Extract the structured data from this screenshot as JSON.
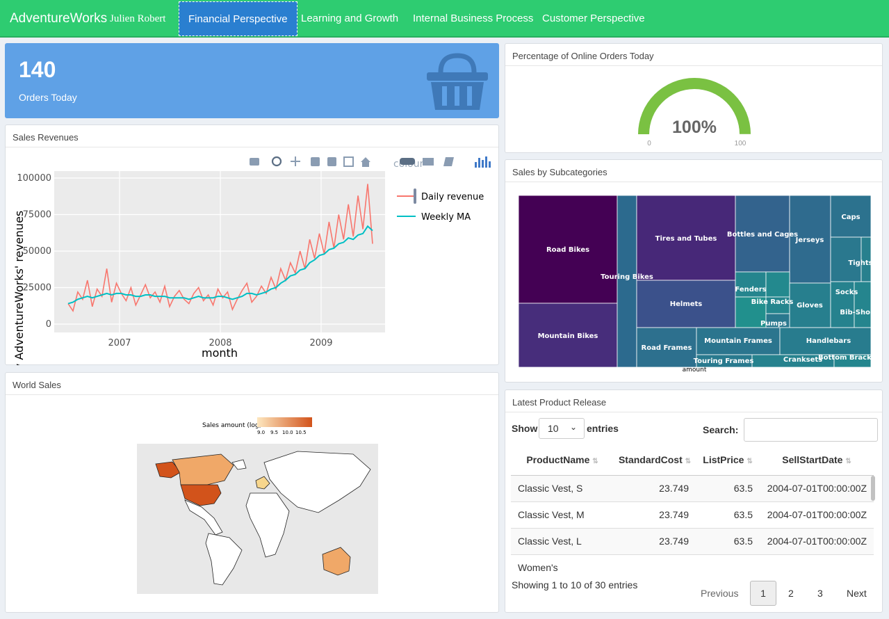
{
  "nav": {
    "brand": "AdventureWorks",
    "user": "Julien Robert",
    "tabs": [
      "Financial Perspective",
      "Learning and Growth",
      "Internal Business Process",
      "Customer Perspective"
    ]
  },
  "orders": {
    "value": "140",
    "label": "Orders Today",
    "icon": "basket-icon"
  },
  "online": {
    "title": "Percentage of Online Orders Today",
    "value": "100%",
    "min": "0",
    "max": "100",
    "level": 1.0,
    "color": "#7ac142"
  },
  "revenue": {
    "title": "Sales Revenues",
    "toolbar_text": "colour",
    "legend": [
      "Daily revenue",
      "Weekly MA"
    ]
  },
  "subcat": {
    "title": "Sales by Subcategories",
    "caption": "amount",
    "labels": [
      "Road Bikes",
      "Mountain Bikes",
      "Touring Bikes",
      "Tires and Tubes",
      "Helmets",
      "Bottles and Cages",
      "Jerseys",
      "Caps",
      "Tights",
      "Fenders",
      "Bike Racks",
      "Pumps",
      "Gloves",
      "Socks",
      "Bib-Shorts",
      "Road Frames",
      "Mountain Frames",
      "Handlebars",
      "Touring Frames",
      "Cranksets",
      "Bottom Brackets"
    ]
  },
  "world": {
    "title": "World Sales",
    "legend_title": "Sales amount (log)",
    "legend_ticks": [
      "9.0",
      "9.5",
      "10.0",
      "10.5"
    ]
  },
  "products": {
    "title": "Latest Product Release",
    "show": "Show",
    "entries_value": "10",
    "entries": "entries",
    "search": "Search:",
    "columns": [
      "ProductName",
      "StandardCost",
      "ListPrice",
      "SellStartDate"
    ],
    "rows": [
      [
        "Classic Vest, S",
        "23.749",
        "63.5",
        "2004-07-01T00:00:00Z"
      ],
      [
        "Classic Vest, M",
        "23.749",
        "63.5",
        "2004-07-01T00:00:00Z"
      ],
      [
        "Classic Vest, L",
        "23.749",
        "63.5",
        "2004-07-01T00:00:00Z"
      ],
      [
        "Women's",
        "",
        "",
        ""
      ]
    ],
    "info": "Showing 1 to 10 of 30 entries",
    "prev": "Previous",
    "pages": [
      "1",
      "2",
      "3"
    ],
    "next": "Next"
  },
  "chart_data": {
    "type": "line",
    "xlabel": "month",
    "ylabel": "Daily AdventureWorks' revenues",
    "x_ticks": [
      "2007",
      "2008",
      "2009"
    ],
    "y_ticks": [
      "0",
      "25000",
      "50000",
      "75000",
      "100000"
    ],
    "ylim": [
      0,
      100000
    ],
    "series": [
      {
        "name": "Daily revenue",
        "color": "#f8766d",
        "values": [
          14000,
          9000,
          22000,
          17000,
          30000,
          12000,
          24000,
          19000,
          38000,
          15000,
          28000,
          21000,
          16000,
          25000,
          13000,
          20000,
          27000,
          18000,
          22000,
          15000,
          26000,
          12000,
          19000,
          23000,
          17000,
          14000,
          21000,
          25000,
          16000,
          20000,
          13000,
          24000,
          18000,
          22000,
          10000,
          17000,
          23000,
          28000,
          15000,
          19000,
          26000,
          21000,
          32000,
          24000,
          38000,
          30000,
          42000,
          35000,
          50000,
          38000,
          58000,
          45000,
          62000,
          48000,
          70000,
          52000,
          75000,
          58000,
          82000,
          60000,
          88000,
          65000,
          96000,
          55000
        ]
      },
      {
        "name": "Weekly MA",
        "color": "#00bfc4",
        "values": [
          14000,
          15000,
          17000,
          18000,
          19000,
          18000,
          19000,
          20000,
          21000,
          20000,
          21000,
          21000,
          20000,
          20000,
          19000,
          19000,
          20000,
          20000,
          19000,
          19000,
          19000,
          18000,
          18000,
          18000,
          18000,
          17000,
          18000,
          19000,
          18000,
          18000,
          18000,
          19000,
          19000,
          18000,
          17000,
          18000,
          19000,
          21000,
          21000,
          20000,
          21000,
          22000,
          24000,
          25000,
          28000,
          30000,
          33000,
          34000,
          37000,
          38000,
          42000,
          44000,
          47000,
          48000,
          51000,
          52000,
          55000,
          56000,
          59000,
          58000,
          61000,
          62000,
          67000,
          64000
        ]
      }
    ]
  }
}
